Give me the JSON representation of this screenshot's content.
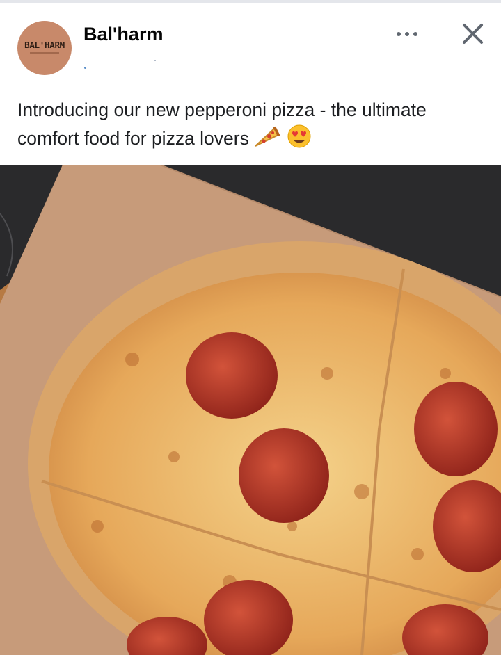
{
  "post": {
    "page_name": "Bal'harm",
    "avatar_text": "BAL'HARM",
    "caption": "Introducing our new pepperoni pizza - the ultimate comfort food for pizza lovers",
    "caption_emojis": [
      "pizza-emoji",
      "heart-eyes-emoji"
    ],
    "actions": {
      "more_icon": "more-horizontal-icon",
      "close_icon": "close-icon"
    },
    "image": {
      "subject": "pepperoni pizza on brown paper over dark marble"
    }
  },
  "colors": {
    "avatar_bg": "#c8896a",
    "text": "#1c1e21",
    "icon": "#606770"
  }
}
